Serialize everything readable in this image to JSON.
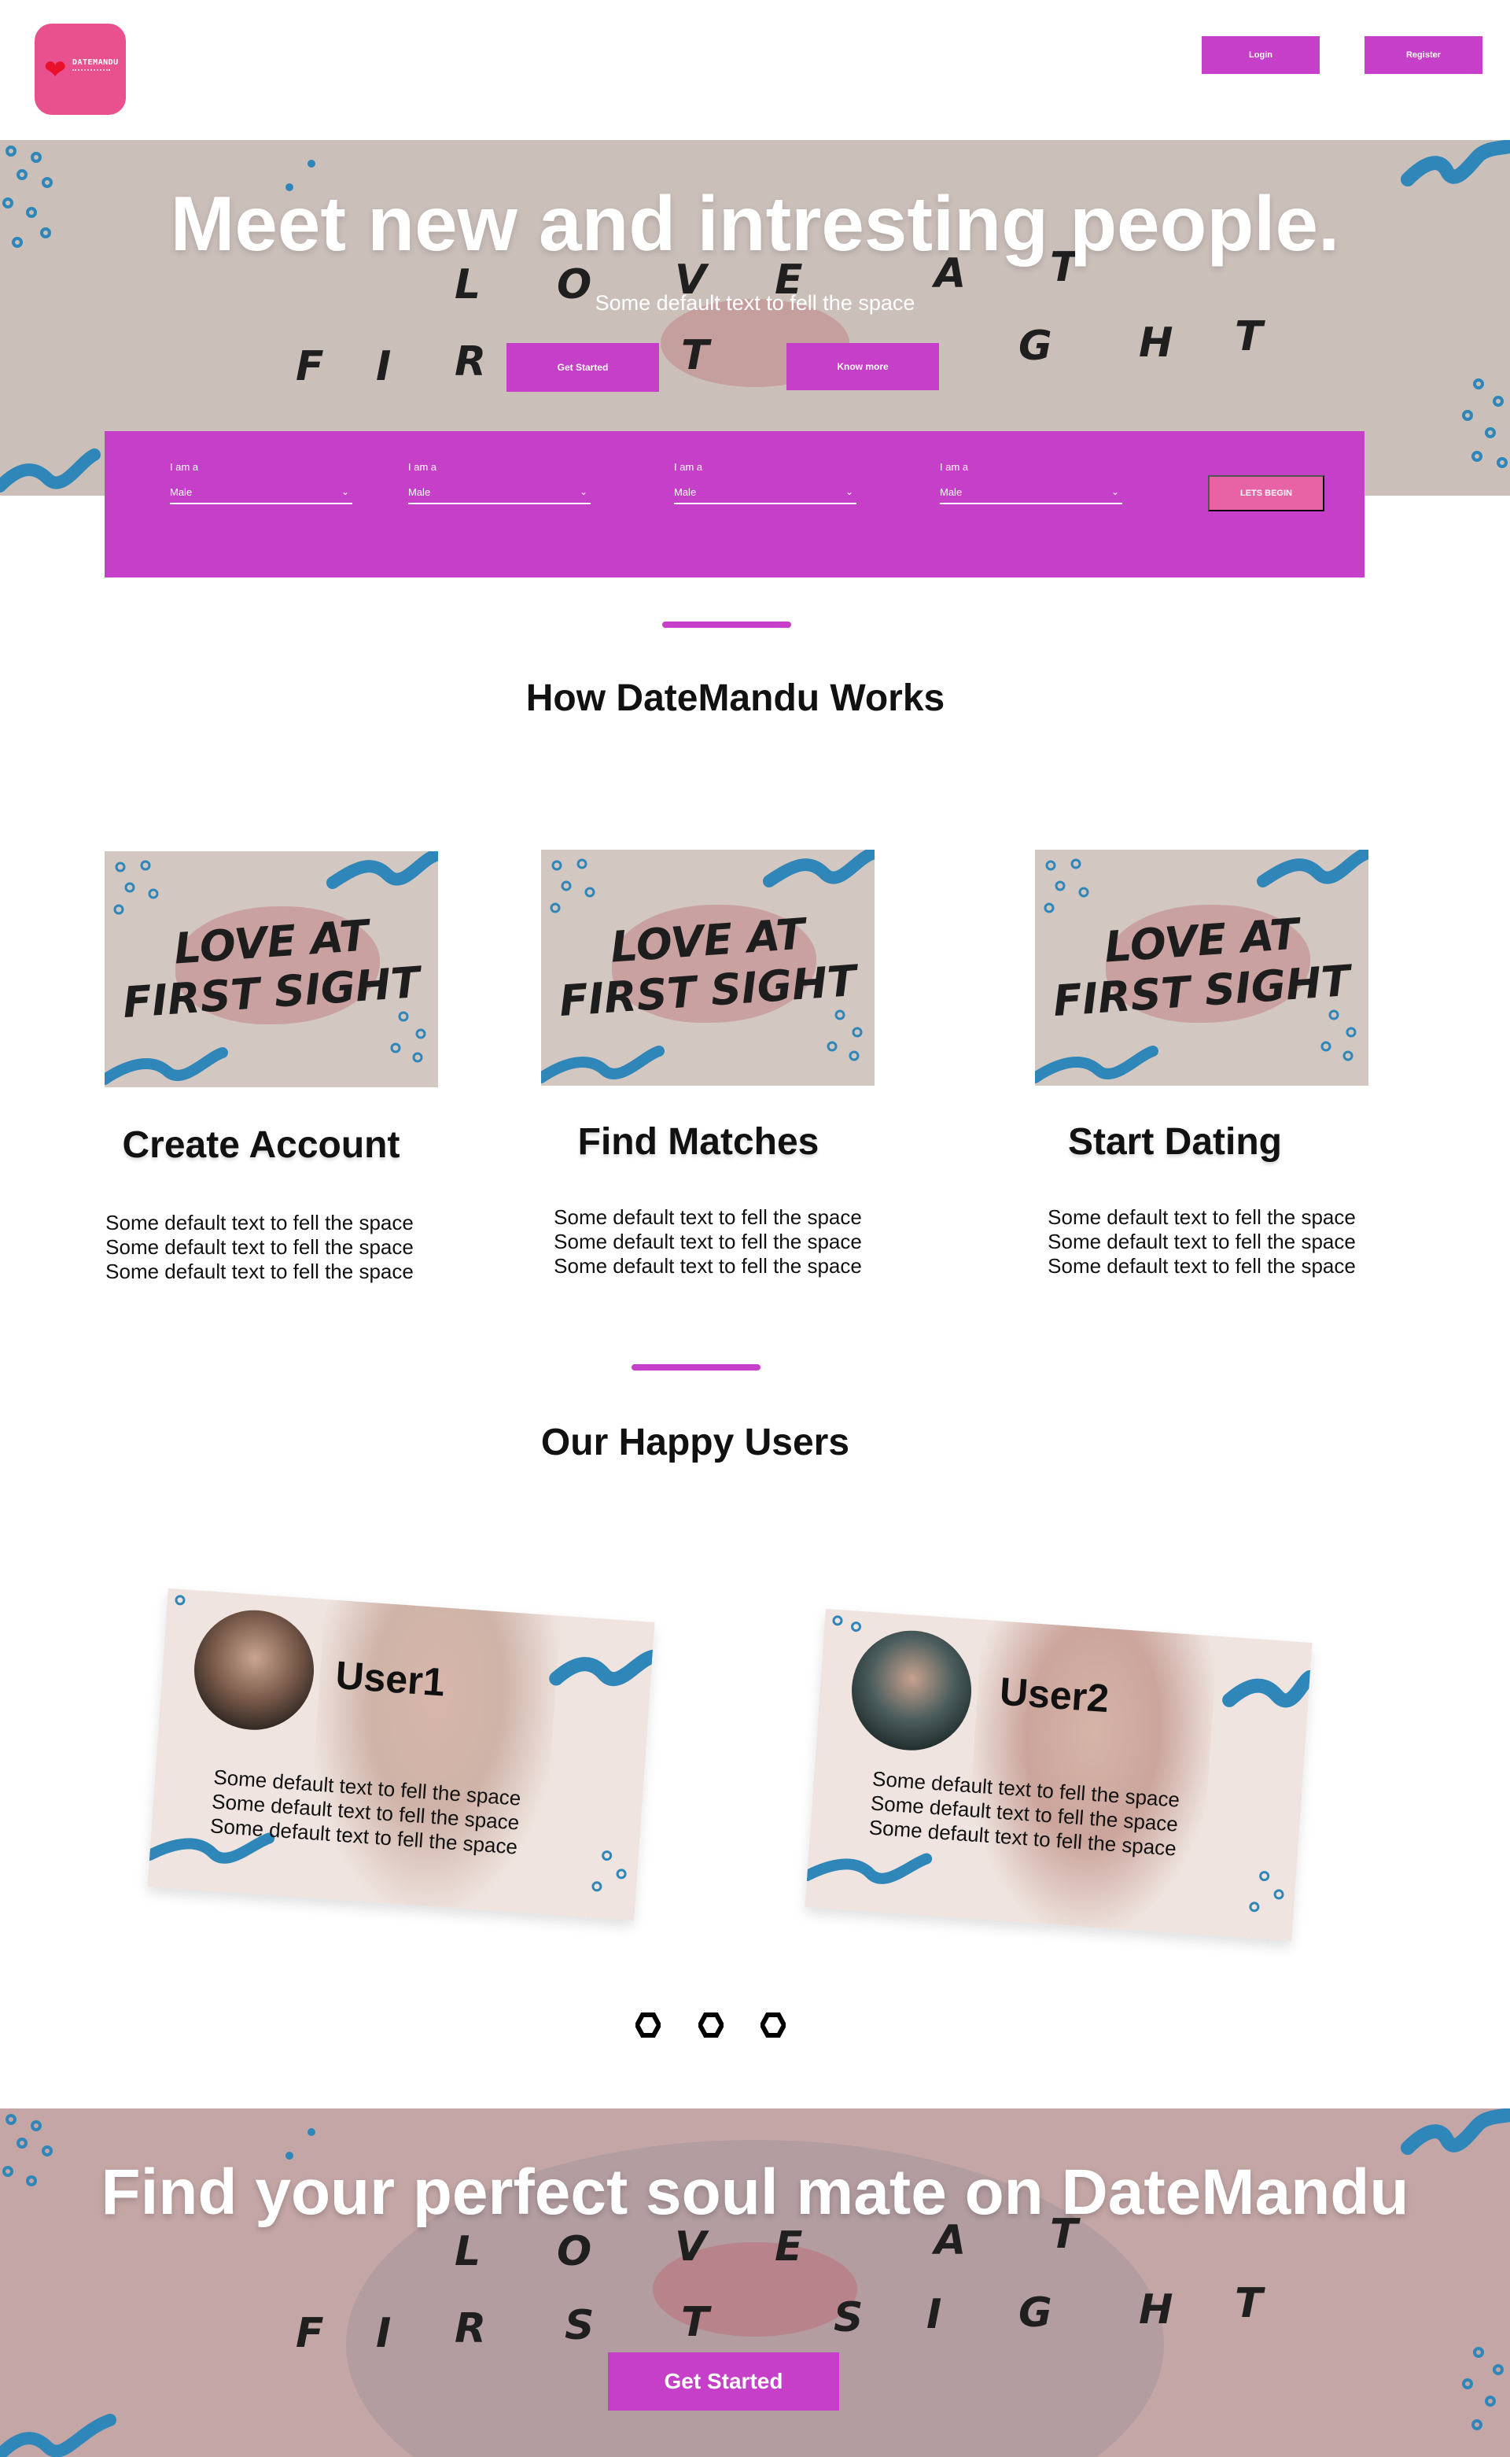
{
  "header": {
    "logo_text": "DATEMANDU",
    "login_label": "Login",
    "register_label": "Register"
  },
  "hero": {
    "title": "Meet new and intresting people.",
    "subtitle": "Some default text to fell the space",
    "get_started_label": "Get Started",
    "know_more_label": "Know more"
  },
  "search": {
    "fields": [
      {
        "label": "I am a",
        "value": "Male"
      },
      {
        "label": "I am a",
        "value": "Male"
      },
      {
        "label": "I am a",
        "value": "Male"
      },
      {
        "label": "I am a",
        "value": "Male"
      }
    ],
    "submit_label": "LETS BEGIN"
  },
  "how_it_works": {
    "title": "How DateMandu Works",
    "image_text_line1": "LOVE AT",
    "image_text_line2": "FIRST SIGHT",
    "steps": [
      {
        "title": "Create Account",
        "lines": [
          "Some default text to fell the space",
          "Some default text to fell the space",
          "Some default text to fell the space"
        ]
      },
      {
        "title": "Find Matches",
        "lines": [
          "Some default text to fell the space",
          "Some default text to fell the space",
          "Some default text to fell the space"
        ]
      },
      {
        "title": "Start Dating",
        "lines": [
          "Some default text to fell the space",
          "Some default text to fell the space",
          "Some default text to fell the space"
        ]
      }
    ]
  },
  "happy_users": {
    "title": "Our Happy Users",
    "users": [
      {
        "name": "User1",
        "lines": [
          "Some default text to fell the space",
          "Some default text to fell the space",
          "Some default text to fell the space"
        ]
      },
      {
        "name": "User2",
        "lines": [
          "Some default text to fell the space",
          "Some default text to fell the space",
          "Some default text to fell the space"
        ]
      }
    ],
    "carousel_pages": 3
  },
  "footer": {
    "title": "Find your perfect soul mate on DateMandu",
    "get_started_label": "Get Started"
  },
  "colors": {
    "accent": "#c63fc8",
    "pink_button": "#e862a6",
    "logo_bg": "#e8508e",
    "hero_bg": "#cbbfba",
    "brush_blue": "#2f86b8"
  }
}
